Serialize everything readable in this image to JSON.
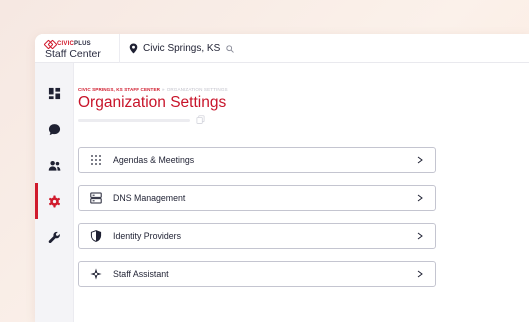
{
  "brand": {
    "logo_prefix": "CIVIC",
    "logo_suffix": "PLUS",
    "product": "Staff Center",
    "accent_color": "#d0192b"
  },
  "header": {
    "location_icon": "map-pin-icon",
    "location": "Civic Springs, KS",
    "search_icon": "search-icon"
  },
  "sidebar": {
    "items": [
      {
        "icon": "dashboard-icon",
        "active": false
      },
      {
        "icon": "chat-bubble-icon",
        "active": false
      },
      {
        "icon": "users-icon",
        "active": false
      },
      {
        "icon": "gear-icon",
        "active": true
      },
      {
        "icon": "wrench-icon",
        "active": false
      }
    ]
  },
  "breadcrumb": {
    "root": "CIVIC SPRINGS, KS STAFF CENTER",
    "separator": "»",
    "current": "ORGANIZATION SETTINGS"
  },
  "page": {
    "title": "Organization Settings",
    "progress_percent": 0,
    "copy_icon": "copy-icon"
  },
  "settings": [
    {
      "label": "Agendas & Meetings",
      "icon": "dot-grid-icon",
      "chevron": ">"
    },
    {
      "label": "DNS Management",
      "icon": "server-icon",
      "chevron": ">"
    },
    {
      "label": "Identity Providers",
      "icon": "shield-icon",
      "chevron": ">"
    },
    {
      "label": "Staff Assistant",
      "icon": "sparkle-icon",
      "chevron": ">"
    }
  ]
}
